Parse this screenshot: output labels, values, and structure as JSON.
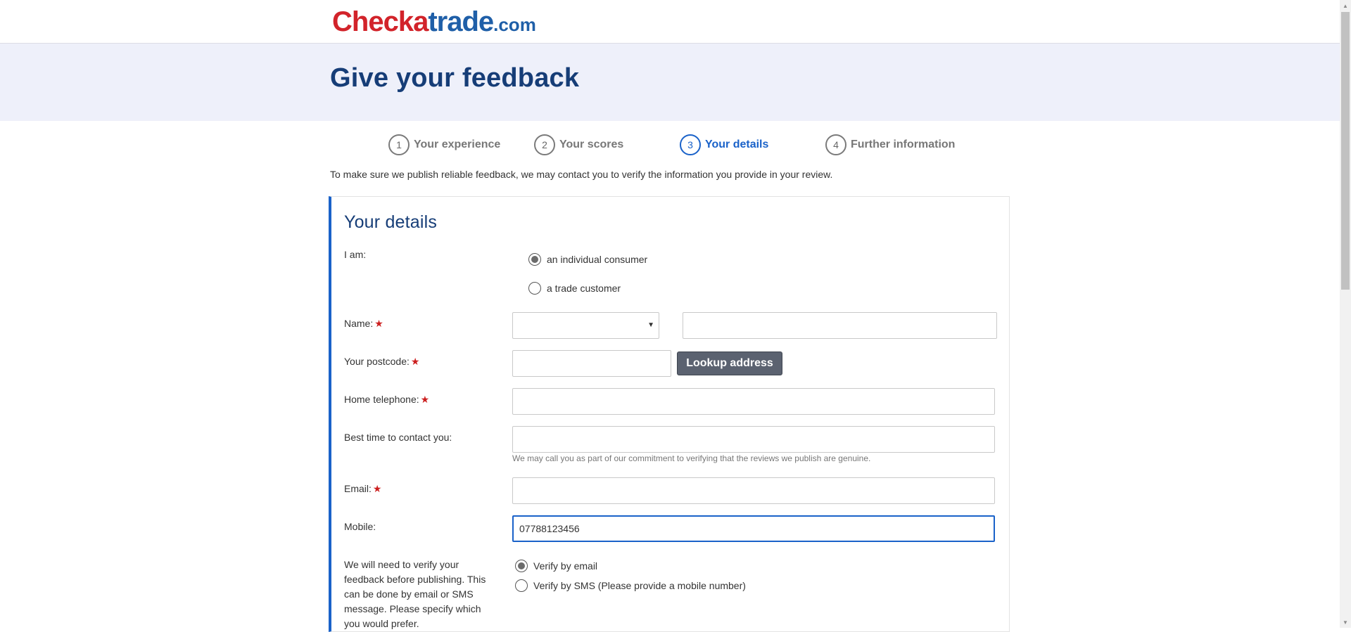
{
  "logo": {
    "part1": "Chec",
    "part2": "k",
    "part3": "a",
    "part4": "trade",
    "part5": ".com"
  },
  "banner": {
    "title": "Give your feedback"
  },
  "steps": [
    {
      "num": "1",
      "label": "Your experience",
      "active": false
    },
    {
      "num": "2",
      "label": "Your scores",
      "active": false
    },
    {
      "num": "3",
      "label": "Your details",
      "active": true
    },
    {
      "num": "4",
      "label": "Further information",
      "active": false
    }
  ],
  "intro": "To make sure we publish reliable feedback, we may contact you to verify the information you provide in your review.",
  "card": {
    "title": "Your details",
    "iam_label": "I am:",
    "iam_options": [
      {
        "label": "an individual consumer",
        "checked": true
      },
      {
        "label": "a trade customer",
        "checked": false
      }
    ],
    "name_label": "Name:",
    "title_select_value": "",
    "name_value": "",
    "postcode_label": "Your postcode:",
    "postcode_value": "",
    "lookup_button": "Lookup address",
    "home_tel_label": "Home telephone:",
    "home_tel_value": "",
    "best_time_label": "Best time to contact you:",
    "best_time_value": "",
    "best_time_help": "We may call you as part of our commitment to verifying that the reviews we publish are genuine.",
    "email_label": "Email:",
    "email_value": "",
    "mobile_label": "Mobile:",
    "mobile_value": "07788123456",
    "verify_text": "We will need to verify your feedback before publishing. This can be done by email or SMS message. Please specify which you would prefer.",
    "verify_options": [
      {
        "label": "Verify by email",
        "checked": true
      },
      {
        "label": "Verify by SMS (Please provide a mobile number)",
        "checked": false
      }
    ],
    "required_mark": "★"
  },
  "colors": {
    "accent": "#1a62c9",
    "heading": "#163d77",
    "brand_red": "#d2232a",
    "required": "#cc1f1f"
  }
}
